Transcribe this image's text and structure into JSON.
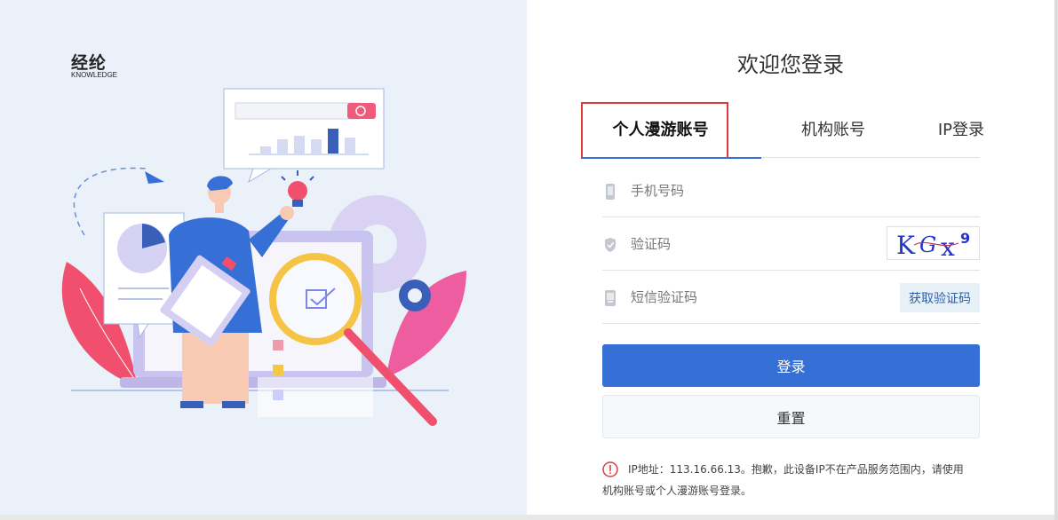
{
  "brand": {
    "name_cn": "经纶",
    "name_en": "KNOWLEDGE"
  },
  "login": {
    "title": "欢迎您登录",
    "tabs": [
      {
        "label": "个人漫游账号",
        "active": true
      },
      {
        "label": "机构账号",
        "active": false
      },
      {
        "label": "IP登录",
        "active": false
      }
    ],
    "phone": {
      "placeholder": "手机号码",
      "value": ""
    },
    "captcha": {
      "placeholder": "验证码",
      "value": "",
      "image_text": "KGx9"
    },
    "sms": {
      "placeholder": "短信验证码",
      "value": "",
      "button_label": "获取验证码"
    },
    "submit_label": "登录",
    "reset_label": "重置",
    "notice_line1": "IP地址：113.16.66.13。抱歉，此设备IP不在产品服务范围内，请使用",
    "notice_line2": "机构账号或个人漫游账号登录。"
  },
  "colors": {
    "primary": "#3670d6",
    "highlight_box": "#e03b3b",
    "notice_icon": "#e03b3b",
    "left_background": "#eaf1f9"
  }
}
